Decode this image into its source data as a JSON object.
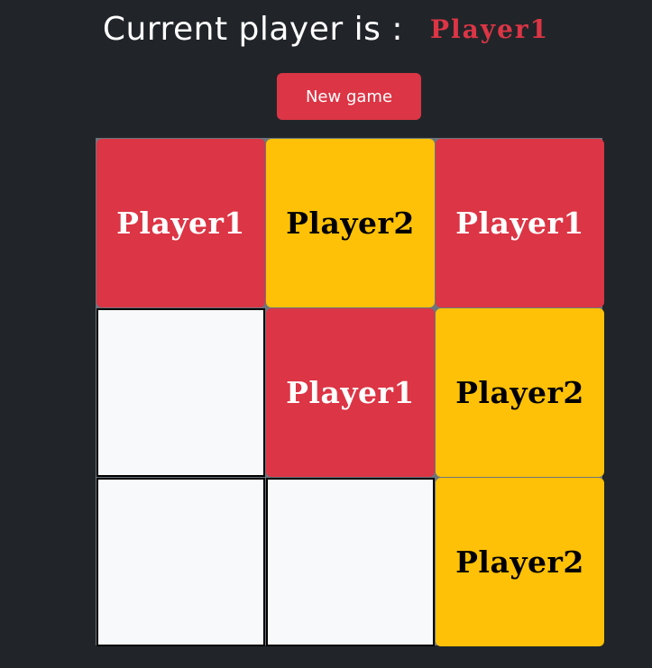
{
  "header": {
    "label": "Current player is :",
    "current_player": "Player1",
    "current_player_color": "#dc3545"
  },
  "controls": {
    "new_game_label": "New game"
  },
  "board": {
    "cells": [
      "Player1",
      "Player2",
      "Player1",
      "",
      "Player1",
      "Player2",
      "",
      "",
      "Player2"
    ]
  },
  "colors": {
    "background": "#212529",
    "player1": "#dc3545",
    "player2": "#ffc107",
    "empty": "#f8f9fa"
  }
}
